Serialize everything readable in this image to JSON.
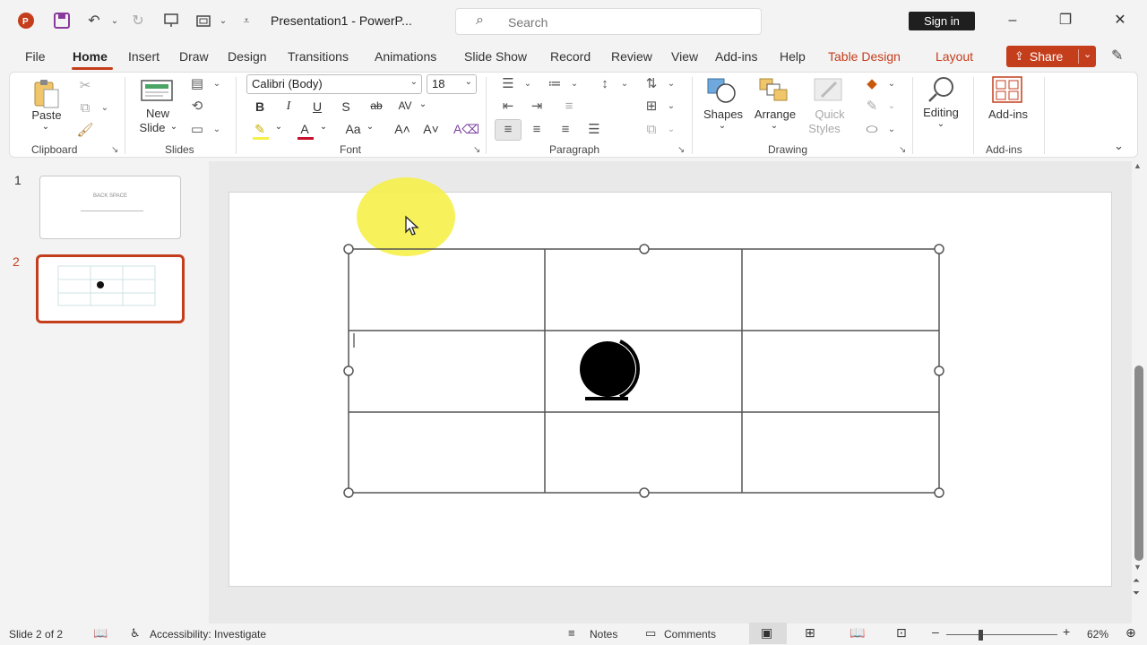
{
  "window": {
    "doc_title": "Presentation1  -  PowerP...",
    "search_placeholder": "Search",
    "sign_in": "Sign in"
  },
  "tabs": [
    {
      "label": "File"
    },
    {
      "label": "Home"
    },
    {
      "label": "Insert"
    },
    {
      "label": "Draw"
    },
    {
      "label": "Design"
    },
    {
      "label": "Transitions"
    },
    {
      "label": "Animations"
    },
    {
      "label": "Slide Show"
    },
    {
      "label": "Record"
    },
    {
      "label": "Review"
    },
    {
      "label": "View"
    },
    {
      "label": "Add-ins"
    },
    {
      "label": "Help"
    },
    {
      "label": "Table Design"
    },
    {
      "label": "Layout"
    }
  ],
  "share_label": "Share",
  "ribbon": {
    "clipboard": {
      "group": "Clipboard",
      "paste": "Paste"
    },
    "slides": {
      "group": "Slides",
      "new_slide_line1": "New",
      "new_slide_line2": "Slide"
    },
    "font": {
      "group": "Font",
      "font_name": "Calibri (Body)",
      "font_size": "18"
    },
    "paragraph": {
      "group": "Paragraph"
    },
    "drawing": {
      "group": "Drawing",
      "shapes": "Shapes",
      "arrange": "Arrange",
      "quick_styles_line1": "Quick",
      "quick_styles_line2": "Styles"
    },
    "editing": {
      "label": "Editing"
    },
    "addins": {
      "group": "Add-ins",
      "label": "Add-ins"
    }
  },
  "thumbnails": [
    {
      "number": "1",
      "title": "BACK SPACE"
    },
    {
      "number": "2"
    }
  ],
  "status": {
    "slide": "Slide 2 of 2",
    "accessibility": "Accessibility: Investigate",
    "notes": "Notes",
    "comments": "Comments",
    "zoom": "62%"
  },
  "colors": {
    "accent": "#c43e1c",
    "highlight": "#f6f04a"
  }
}
